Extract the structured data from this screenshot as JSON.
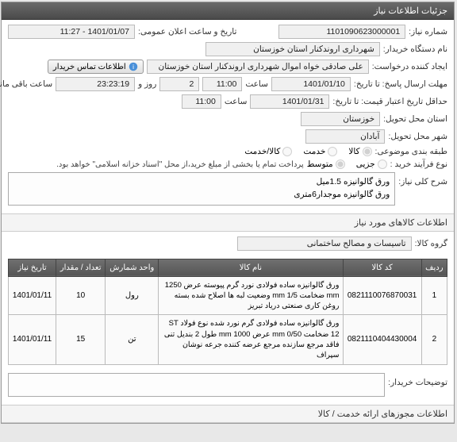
{
  "header": {
    "title": "جزئیات اطلاعات نیاز"
  },
  "form": {
    "req_no_label": "شماره نیاز:",
    "req_no": "1101090623000001",
    "announce_label": "تاریخ و ساعت اعلان عمومی:",
    "announce_value": "1401/01/07 - 11:27",
    "buyer_label": "نام دستگاه خریدار:",
    "buyer_value": "شهرداری اروندکنار استان خوزستان",
    "creator_label": "ایجاد کننده درخواست:",
    "creator_value": "علی صادقی خواه اموال شهرداری اروندکنار استان خوزستان",
    "contact_btn": "اطلاعات تماس خریدار",
    "deadline_label": "مهلت ارسال پاسخ: تا تاریخ:",
    "deadline_date": "1401/01/10",
    "time_label": "ساعت",
    "deadline_time": "11:00",
    "days_label": "روز و",
    "days_value": "2",
    "remain_label": "ساعت باقی مانده",
    "remain_value": "23:23:19",
    "validity_label": "حداقل تاریخ اعتبار قیمت: تا تاریخ:",
    "validity_date": "1401/01/31",
    "validity_time": "11:00",
    "province_label": "استان محل تحویل:",
    "province_value": "خوزستان",
    "city_label": "شهر محل تحویل:",
    "city_value": "آبادان",
    "class_label": "طبقه بندی موضوعی:",
    "class_opts": {
      "goods": "کالا",
      "service": "خدمت",
      "both": "کالا/خدمت"
    },
    "process_label": "نوع فرآیند خرید :",
    "process_opts": {
      "low": "جزیی",
      "mid": "متوسط"
    },
    "process_note": "پرداخت تمام یا بخشی از مبلغ خرید،از محل \"اسناد خزانه اسلامی\" خواهد بود.",
    "summary_label": "شرح کلی نیاز:",
    "summary_line1": "ورق گالوانیزه 1.5میل",
    "summary_line2": "ورق گالوانیزه موجدار6متری"
  },
  "goods_section": {
    "title": "اطلاعات کالاهای مورد نیاز",
    "group_label": "گروه کالا:",
    "group_value": "تاسیسات و مصالح ساختمانی"
  },
  "table": {
    "headers": [
      "ردیف",
      "کد کالا",
      "نام کالا",
      "واحد شمارش",
      "تعداد / مقدار",
      "تاریخ نیاز"
    ],
    "rows": [
      {
        "idx": "1",
        "code": "0821110076870031",
        "name": "ورق گالوانیزه ساده فولادی نورد گرم پیوسته عرض 1250 mm ضخامت 1/5 mm وضعیت لبه ها اصلاح شده بسته روغن کاری صنعتی دریاد تبریز",
        "unit": "رول",
        "qty": "10",
        "date": "1401/01/11"
      },
      {
        "idx": "2",
        "code": "0821110404430004",
        "name": "ورق گالوانیزه ساده فولادی گرم نورد شده نوع فولاد ST 12 ضخامت 0/50 mm عرض 1000 mm طول 2 بندیل تنی فاقد مرجع سازنده مرجع عرضه کننده جرعه نوشان سپراف",
        "unit": "تن",
        "qty": "15",
        "date": "1401/01/11"
      }
    ]
  },
  "buyer_notes": {
    "label": "توضیحات خریدار:"
  },
  "footer": {
    "title": "اطلاعات مجوزهای ارائه خدمت / کالا"
  }
}
